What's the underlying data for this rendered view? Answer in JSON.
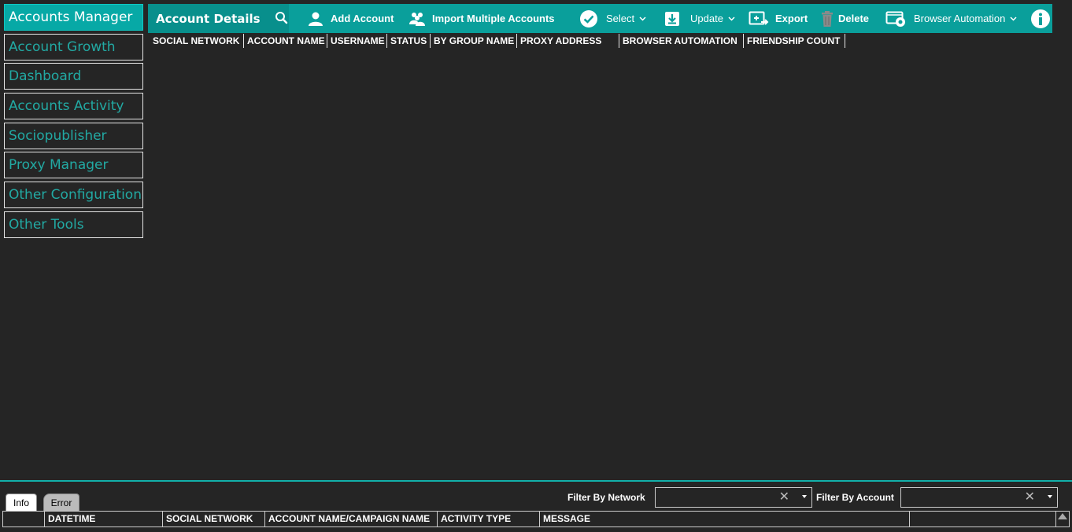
{
  "sidebar": {
    "items": [
      {
        "label": "Accounts Manager"
      },
      {
        "label": "Account Growth"
      },
      {
        "label": "Dashboard"
      },
      {
        "label": "Accounts Activity"
      },
      {
        "label": "Sociopublisher"
      },
      {
        "label": "Proxy Manager"
      },
      {
        "label": "Other Configurations"
      },
      {
        "label": "Other Tools"
      }
    ],
    "active_index": 0
  },
  "toolbar": {
    "title": "Account Details",
    "add_account": "Add Account",
    "import_multiple": "Import Multiple Accounts",
    "select": "Select",
    "update": "Update",
    "export": "Export",
    "delete": "Delete",
    "browser_automation": "Browser Automation"
  },
  "grid": {
    "columns": [
      "SOCIAL NETWORK",
      "ACCOUNT NAME",
      "USERNAME",
      "STATUS",
      "BY GROUP NAME",
      "PROXY ADDRESS",
      "BROWSER AUTOMATION",
      "FRIENDSHIP COUNT"
    ]
  },
  "bottom": {
    "tabs": [
      "Info",
      "Error"
    ],
    "filter_network_label": "Filter By Network",
    "filter_account_label": "Filter By Account",
    "columns": [
      "",
      "DATETIME",
      "SOCIAL NETWORK",
      "ACCOUNT NAME/CAMPAIGN NAME",
      "ACTIVITY TYPE",
      "MESSAGE",
      ""
    ]
  },
  "colors": {
    "accent": "#0a9f9b",
    "sidebar_text": "#22a9a3",
    "background": "#252525"
  }
}
